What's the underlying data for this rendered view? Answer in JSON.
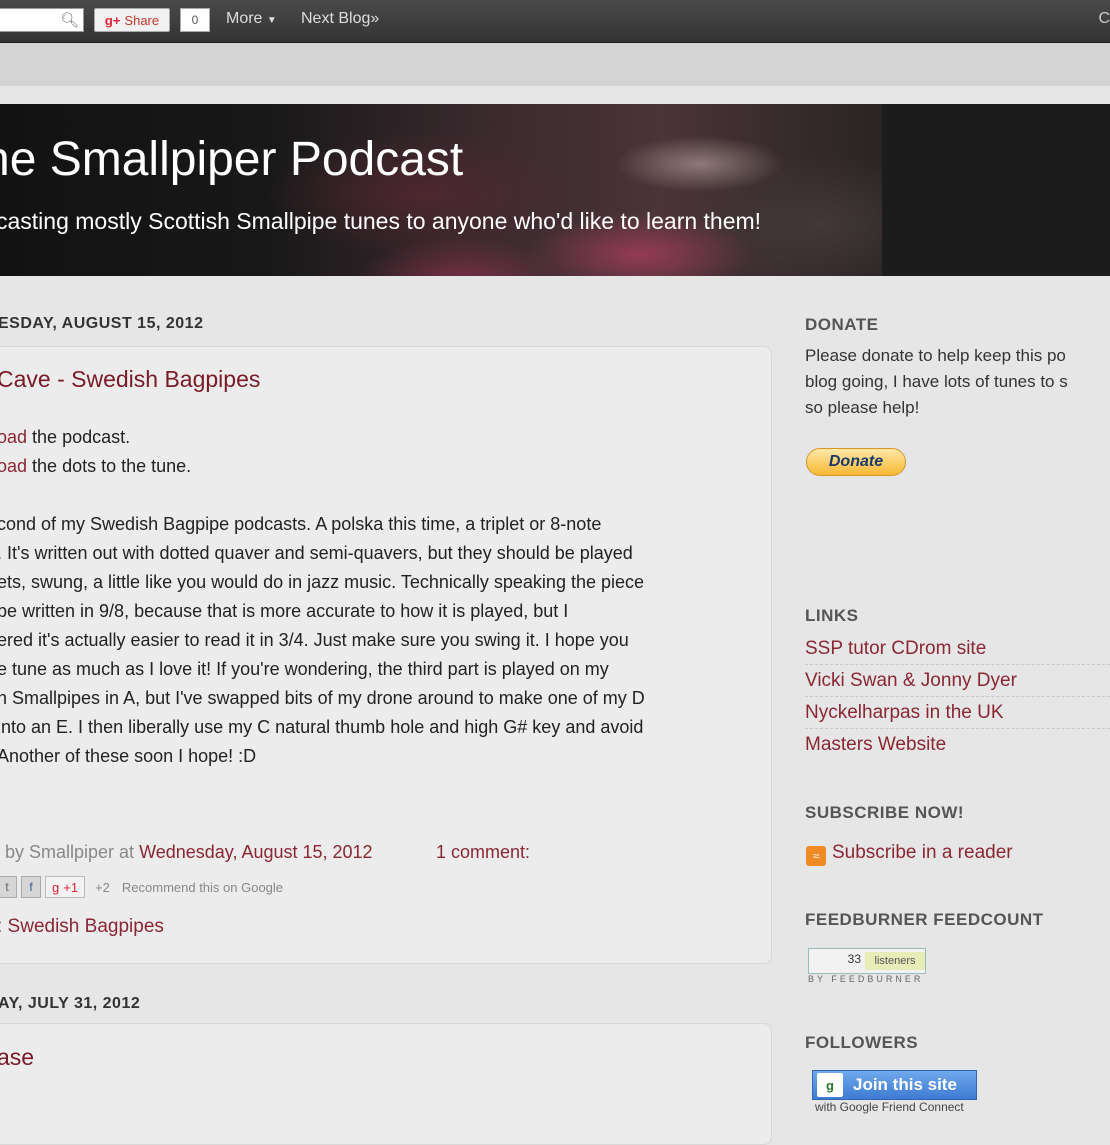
{
  "navbar": {
    "share_label": "Share",
    "share_count": "0",
    "more_label": "More",
    "next_blog_label": "Next Blog»"
  },
  "header": {
    "title": "he Smallpiper Podcast",
    "description": "casting mostly Scottish Smallpipe tunes to anyone who'd like to learn them!"
  },
  "posts": [
    {
      "date": "ESDAY, AUGUST 15, 2012",
      "title": "Cave - Swedish Bagpipes",
      "download_lines": [
        {
          "link": "oad",
          "text": " the podcast."
        },
        {
          "link": "oad",
          "text": " the dots to the tune."
        }
      ],
      "body_lines": [
        "cond of my Swedish Bagpipe podcasts. A polska this time, a triplet or 8-note",
        ". It's written out with dotted quaver and semi-quavers, but they should be played",
        "ets, swung, a little like you would do in jazz music. Technically speaking the piece",
        " be written in 9/8, because that is more accurate to how it is played, but I",
        "ered it's actually easier to read it in 3/4. Just make sure you swing it. I hope you",
        "e tune as much as I love it! If you're wondering, the third part is played on my",
        "h Smallpipes in A, but I've swapped bits of my drone around to make one of my D",
        " into an E. I then liberally use my C natural thumb hole and high G# key and avoid",
        "Another of these soon I hope! :D"
      ],
      "footer": {
        "posted_by": "by Smallpiper at ",
        "timestamp": "Wednesday, August 15, 2012",
        "comments": "1 comment:",
        "plus_one": "+1",
        "plus_count": "+2",
        "recommend": "Recommend this on Google",
        "labels": ": Swedish Bagpipes"
      }
    },
    {
      "date": "AY, JULY 31, 2012",
      "title": "ase"
    }
  ],
  "sidebar": {
    "donate": {
      "heading": "DONATE",
      "lines": [
        "Please donate to help keep this po",
        "blog going, I have lots of tunes to s",
        "so please help!"
      ],
      "button_label": "Donate"
    },
    "links": {
      "heading": "LINKS",
      "items": [
        "SSP tutor CDrom site",
        "Vicki Swan & Jonny Dyer",
        "Nyckelharpas in the UK",
        "Masters Website"
      ]
    },
    "subscribe": {
      "heading": "SUBSCRIBE NOW!",
      "link": "Subscribe in a reader"
    },
    "feedcount": {
      "heading": "FEEDBURNER FEEDCOUNT",
      "count": "33",
      "label": "listeners",
      "sub": "BY FEEDBURNER"
    },
    "followers": {
      "heading": "FOLLOWERS",
      "button_label": "Join this site",
      "sub": "with Google Friend Connect"
    }
  },
  "colors": {
    "link": "#8a2733",
    "title": "#7a1a26",
    "navbar": "#3d3d3d"
  }
}
